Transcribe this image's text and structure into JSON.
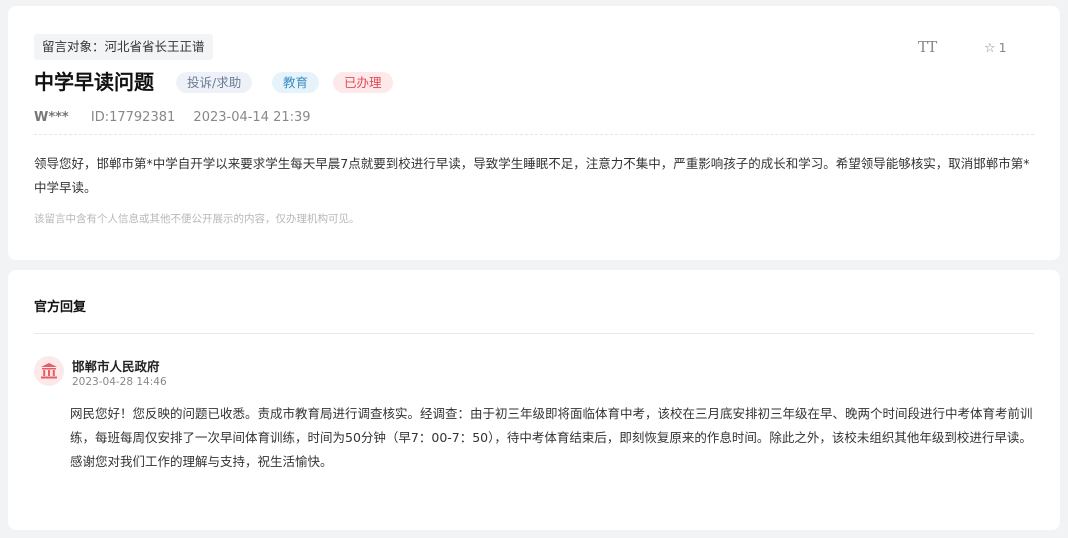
{
  "message": {
    "target_label": "留言对象：河北省省长王正谱",
    "title": "中学早读问题",
    "tags": {
      "type": "投诉/求助",
      "category": "教育",
      "status": "已办理"
    },
    "toolbar": {
      "font_size_glyph": "TT",
      "favorite_count": "1",
      "favorite_icon": "star-icon"
    },
    "author": "W***",
    "id_text": "ID:17792381",
    "datetime": "2023-04-14 21:39",
    "content": "领导您好，邯郸市第*中学自开学以来要求学生每天早晨7点就要到校进行早读，导致学生睡眠不足，注意力不集中，严重影响孩子的成长和学习。希望领导能够核实，取消邯郸市第*中学早读。",
    "privacy_note": "该留言中含有个人信息或其他不便公开展示的内容，仅办理机构可见。"
  },
  "reply": {
    "heading": "官方回复",
    "org_icon": "government-building-icon",
    "org_name": "邯郸市人民政府",
    "datetime": "2023-04-28 14:46",
    "text": "网民您好！您反映的问题已收悉。责成市教育局进行调查核实。经调查：由于初三年级即将面临体育中考，该校在三月底安排初三年级在早、晚两个时间段进行中考体育考前训练，每班每周仅安排了一次早间体育训练，时间为50分钟（早7：00-7：50），待中考体育结束后，即刻恢复原来的作息时间。除此之外，该校未组织其他年级到校进行早读。感谢您对我们工作的理解与支持，祝生活愉快。"
  },
  "colors": {
    "tag_status_text": "#e04b5a",
    "tag_category_text": "#3b8ec2",
    "tag_type_text": "#6b7b93",
    "avatar_bg": "#fde9ea",
    "avatar_icon": "#e85d64"
  }
}
